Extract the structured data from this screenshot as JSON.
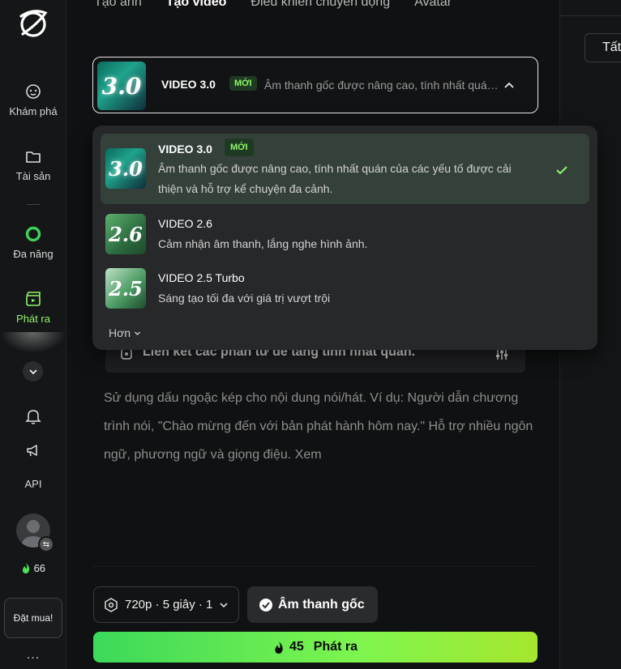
{
  "sidebar": {
    "items": [
      {
        "label": "Khám phá",
        "icon": "explore-icon"
      },
      {
        "label": "Tài sản",
        "icon": "folder-icon"
      },
      {
        "label": "Đa năng",
        "icon": "ring-icon"
      },
      {
        "label": "Phát ra",
        "icon": "clapper-icon"
      }
    ],
    "api_label": "API",
    "credits": "66",
    "buy_label": "Đặt mua!",
    "more": "..."
  },
  "tabs": [
    "Tạo ảnh",
    "Tạo video",
    "Điều khiển chuyển động",
    "Avatar"
  ],
  "model_select": {
    "title": "VIDEO 3.0",
    "badge": "MỚI",
    "desc": "Âm thanh gốc được nâng cao, tính nhất quán của các yếu tố được cải thiện và hỗ trợ kể chuyện đa cảnh."
  },
  "dropdown": {
    "options": [
      {
        "title": "VIDEO 3.0",
        "badge": "MỚI",
        "desc_line1": "Âm thanh gốc được nâng cao, tính nhất quán của các yếu tố được cải",
        "desc_line2": "thiện và hỗ trợ kể chuyện đa cảnh.",
        "thumb": "3.0",
        "selected": true
      },
      {
        "title": "VIDEO 2.6",
        "desc": "Cảm nhận âm thanh, lắng nghe hình ảnh.",
        "thumb": "2.6"
      },
      {
        "title": "VIDEO 2.5 Turbo",
        "desc": "Sáng tạo tối đa với giá trị vượt trội",
        "thumb": "2.5"
      }
    ],
    "more_label": "Hơn"
  },
  "link_bar": {
    "label": "Liên kết các phần tử để tăng tính nhất quán."
  },
  "prompt_placeholder": "Sử dụng dấu ngoặc kép cho nội dung nói/hát. Ví dụ: Người dẫn chương trình nói, \"Chào mừng đến với bản phát hành hôm nay.\" Hỗ trợ nhiều ngôn ngữ, phương ngữ và giọng điệu. Xem",
  "settings_label": "720p · 5 giây · 1",
  "sound_label": "Âm thanh gốc",
  "generate": {
    "cost": "45",
    "label": "Phát ra"
  },
  "right_panel": {
    "tab_label": "Tất"
  },
  "colors": {
    "accent": "#8ff56a",
    "selected_bg": "#34413a",
    "badge_bg": "#1f3a22"
  }
}
